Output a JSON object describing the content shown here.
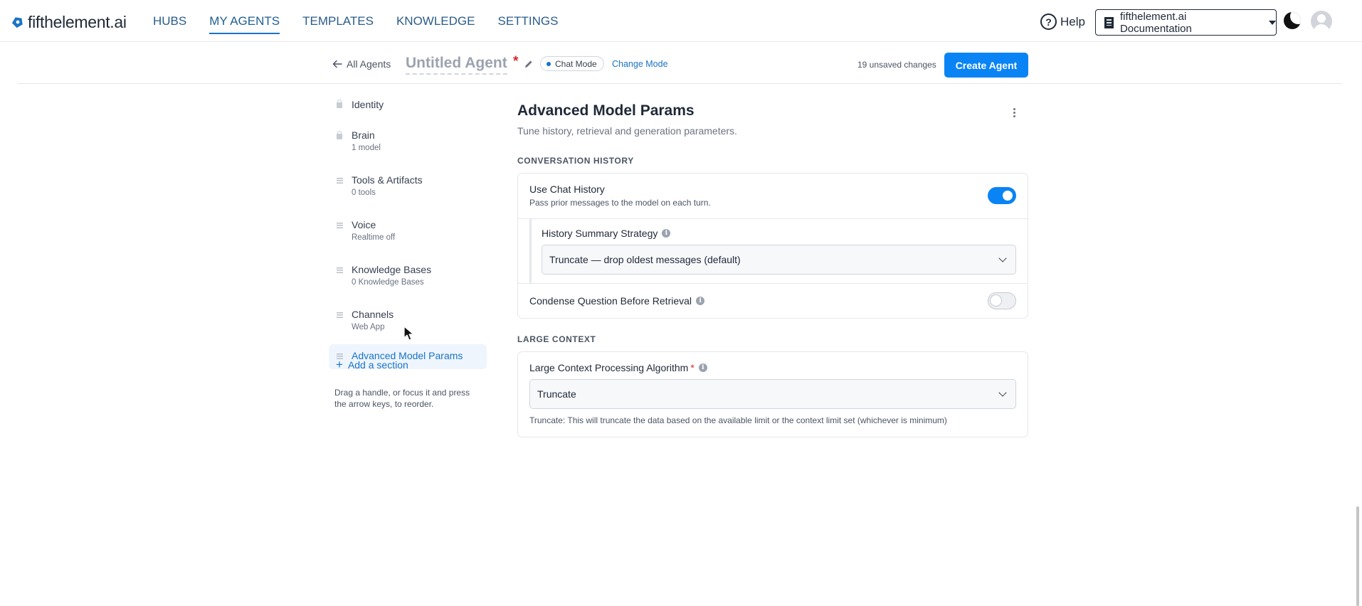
{
  "brand": {
    "name": "fifthelement.ai"
  },
  "nav": {
    "links": [
      "HUBS",
      "MY AGENTS",
      "TEMPLATES",
      "KNOWLEDGE",
      "SETTINGS"
    ],
    "active": "MY AGENTS",
    "help_label": "Help",
    "help_glyph": "?",
    "org_label": "fifthelement.ai Documentation"
  },
  "subheader": {
    "back_label": "All Agents",
    "agent_title": "Untitled Agent",
    "required_mark": "*",
    "mode_label": "Chat Mode",
    "change_mode_label": "Change Mode",
    "unsaved_text": "19 unsaved changes",
    "create_button": "Create Agent"
  },
  "sidebar": {
    "items": [
      {
        "label": "Identity",
        "sub": "",
        "icon": "lock-icon"
      },
      {
        "label": "Brain",
        "sub": "1 model",
        "icon": "lock-icon"
      },
      {
        "label": "Tools & Artifacts",
        "sub": "0 tools",
        "icon": "drag-handle-icon"
      },
      {
        "label": "Voice",
        "sub": "Realtime off",
        "icon": "drag-handle-icon"
      },
      {
        "label": "Knowledge Bases",
        "sub": "0 Knowledge Bases",
        "icon": "drag-handle-icon"
      },
      {
        "label": "Channels",
        "sub": "Web App",
        "icon": "drag-handle-icon"
      },
      {
        "label": "Advanced Model Params",
        "sub": "",
        "icon": "drag-handle-icon",
        "active": true
      }
    ],
    "add_section_label": "Add a section",
    "add_glyph": "+",
    "drag_hint": "Drag a handle, or focus it and press the arrow keys, to reorder."
  },
  "main": {
    "title": "Advanced Model Params",
    "subtitle": "Tune history, retrieval and generation parameters.",
    "conversation_history": {
      "section_label": "CONVERSATION HISTORY",
      "use_chat_history": {
        "title": "Use Chat History",
        "desc": "Pass prior messages to the model on each turn.",
        "enabled": true
      },
      "history_summary_strategy": {
        "title": "History Summary Strategy",
        "value": "Truncate — drop oldest messages (default)"
      },
      "condense_question": {
        "title": "Condense Question Before Retrieval",
        "enabled": false
      }
    },
    "large_context": {
      "section_label": "LARGE CONTEXT",
      "algorithm": {
        "title": "Large Context Processing Algorithm",
        "required_mark": "*",
        "value": "Truncate",
        "helper": "Truncate: This will truncate the data based on the available limit or the context limit set (whichever is minimum)"
      }
    },
    "info_glyph": "i"
  },
  "colors": {
    "accent": "#0a84f5",
    "link": "#1a73c7",
    "nav_text": "#2b5c8a",
    "required": "#dc2626"
  }
}
